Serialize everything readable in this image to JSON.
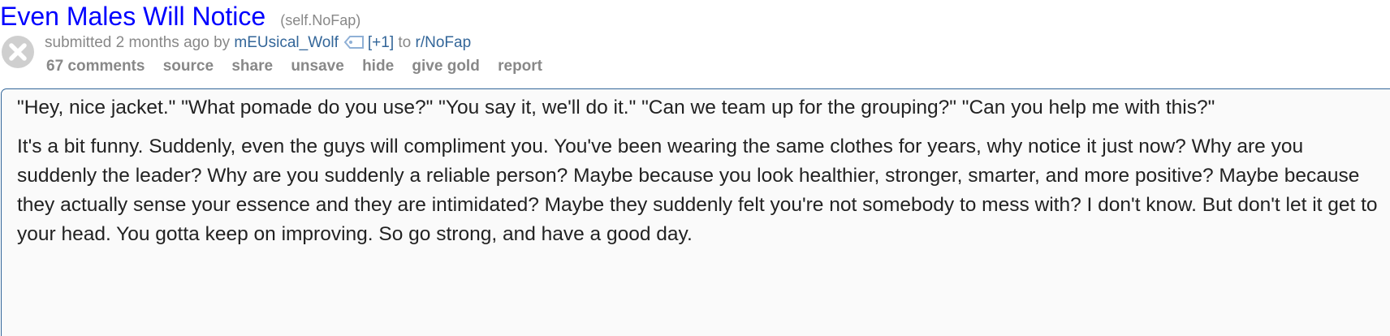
{
  "post": {
    "title": "Even Males Will Notice",
    "domain": "(self.NoFap)",
    "tagline": {
      "prefix": "submitted 2 months ago by ",
      "author": "mEUsical_Wolf",
      "flair": "[+1]",
      "to_text": " to ",
      "subreddit": "r/NoFap"
    },
    "buttons": {
      "comments": "67 comments",
      "source": "source",
      "share": "share",
      "unsave": "unsave",
      "hide": "hide",
      "give_gold": "give gold",
      "report": "report"
    },
    "body": {
      "paragraph1": "\"Hey, nice jacket.\" \"What pomade do you use?\" \"You say it, we'll do it.\" \"Can we team up for the grouping?\" \"Can you help me with this?\"",
      "paragraph2": "It's a bit funny. Suddenly, even the guys will compliment you. You've been wearing the same clothes for years, why notice it just now? Why are you suddenly the leader? Why are you suddenly a reliable person? Maybe because you look healthier, stronger, smarter, and more positive? Maybe because they actually sense your essence and they are intimidated? Maybe they suddenly felt you're not somebody to mess with? I don't know. But don't let it get to your head. You gotta keep on improving. So go strong, and have a good day."
    }
  },
  "colors": {
    "title": "#0000ff",
    "meta": "#888888",
    "link": "#336699",
    "body_text": "#222222",
    "box_border": "#336699"
  },
  "icons": {
    "close": "close-x-icon",
    "flair": "tag-icon"
  }
}
